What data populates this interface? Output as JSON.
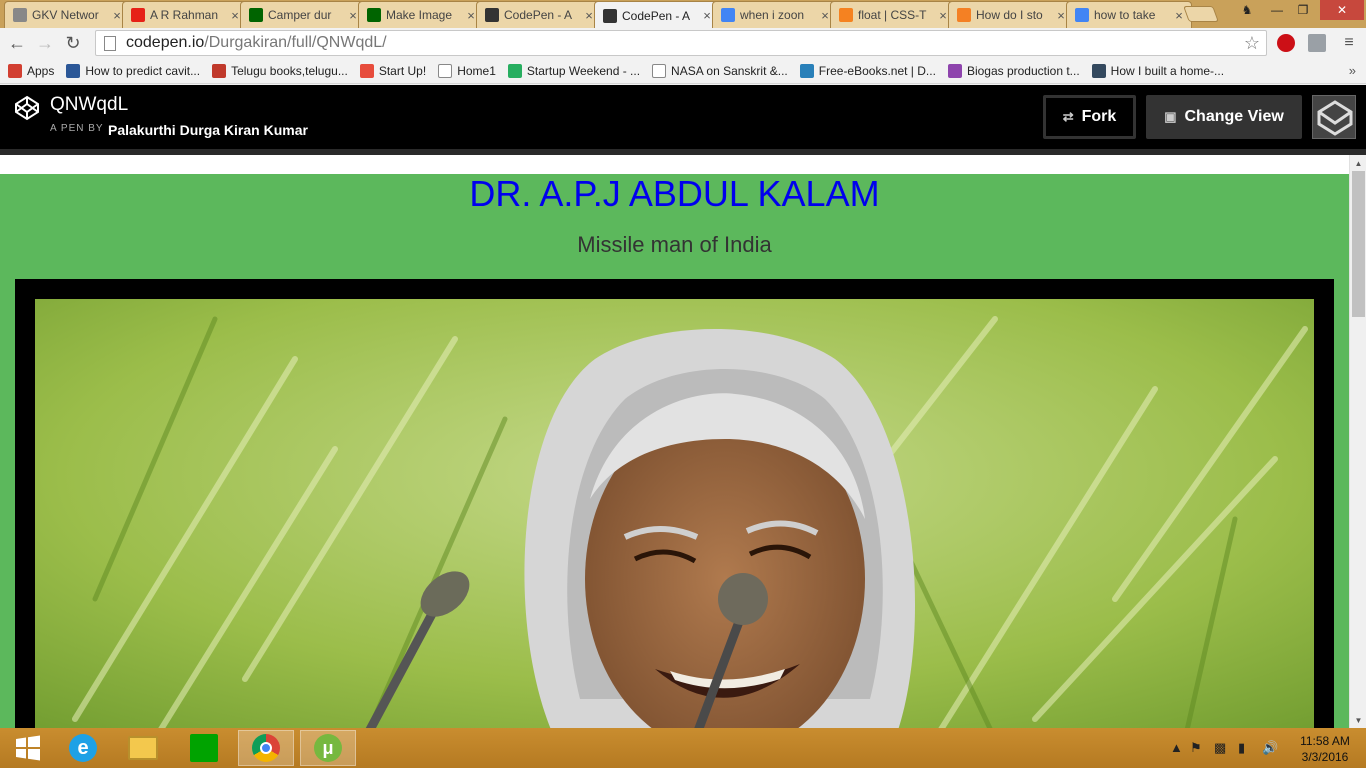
{
  "browser": {
    "tabs": [
      {
        "title": "GKV Networ",
        "icon": "page-icon",
        "color": "#888888"
      },
      {
        "title": "A R Rahman",
        "icon": "youtube-icon",
        "color": "#e62117"
      },
      {
        "title": "Camper dur",
        "icon": "fcc-icon",
        "color": "#006400"
      },
      {
        "title": "Make Image",
        "icon": "fcc-icon",
        "color": "#006400"
      },
      {
        "title": "CodePen - A",
        "icon": "codepen-icon",
        "color": "#333333"
      },
      {
        "title": "CodePen - A",
        "icon": "codepen-icon",
        "color": "#333333",
        "active": true
      },
      {
        "title": "when i zoon",
        "icon": "google-icon",
        "color": "#4285f4"
      },
      {
        "title": "float | CSS-T",
        "icon": "css-tricks-icon",
        "color": "#f58220"
      },
      {
        "title": "How do I sto",
        "icon": "stackoverflow-icon",
        "color": "#f48024"
      },
      {
        "title": "how to take",
        "icon": "google-icon",
        "color": "#4285f4"
      }
    ],
    "url_host": "codepen.io",
    "url_path": "/Durgakiran/full/QNWqdL/",
    "bookmarks": [
      {
        "label": "Apps",
        "icon": "apps-grid-icon",
        "color": "#d23f31"
      },
      {
        "label": "How to predict cavit...",
        "icon": "site-icon",
        "color": "#2b5797"
      },
      {
        "label": "Telugu books,telugu...",
        "icon": "book-icon",
        "color": "#c0392b"
      },
      {
        "label": "Start Up!",
        "icon": "start-icon",
        "color": "#e74c3c"
      },
      {
        "label": "Home1",
        "icon": "page-icon",
        "color": "#ffffff"
      },
      {
        "label": "Startup Weekend - ...",
        "icon": "startup-weekend-icon",
        "color": "#27ae60"
      },
      {
        "label": "NASA on Sanskrit &...",
        "icon": "page-icon",
        "color": "#ffffff"
      },
      {
        "label": "Free-eBooks.net | D...",
        "icon": "ebook-icon",
        "color": "#2980b9"
      },
      {
        "label": "Biogas production t...",
        "icon": "site-icon",
        "color": "#8e44ad"
      },
      {
        "label": "How I built a home-...",
        "icon": "site-icon",
        "color": "#34495e"
      }
    ],
    "bookmarks_more": "»"
  },
  "codepen": {
    "pen_title": "QNWqdL",
    "by_label": "A PEN BY",
    "author": "Palakurthi Durga Kiran Kumar",
    "fork_label": "Fork",
    "change_view_label": "Change View"
  },
  "page": {
    "heading": "DR. A.P.J ABDUL KALAM",
    "subheading": "Missile man of India",
    "colors": {
      "background": "#5cb85c",
      "heading": "#0000ee",
      "frame": "#000000"
    }
  },
  "taskbar": {
    "time": "11:58 AM",
    "date": "3/3/2016"
  }
}
